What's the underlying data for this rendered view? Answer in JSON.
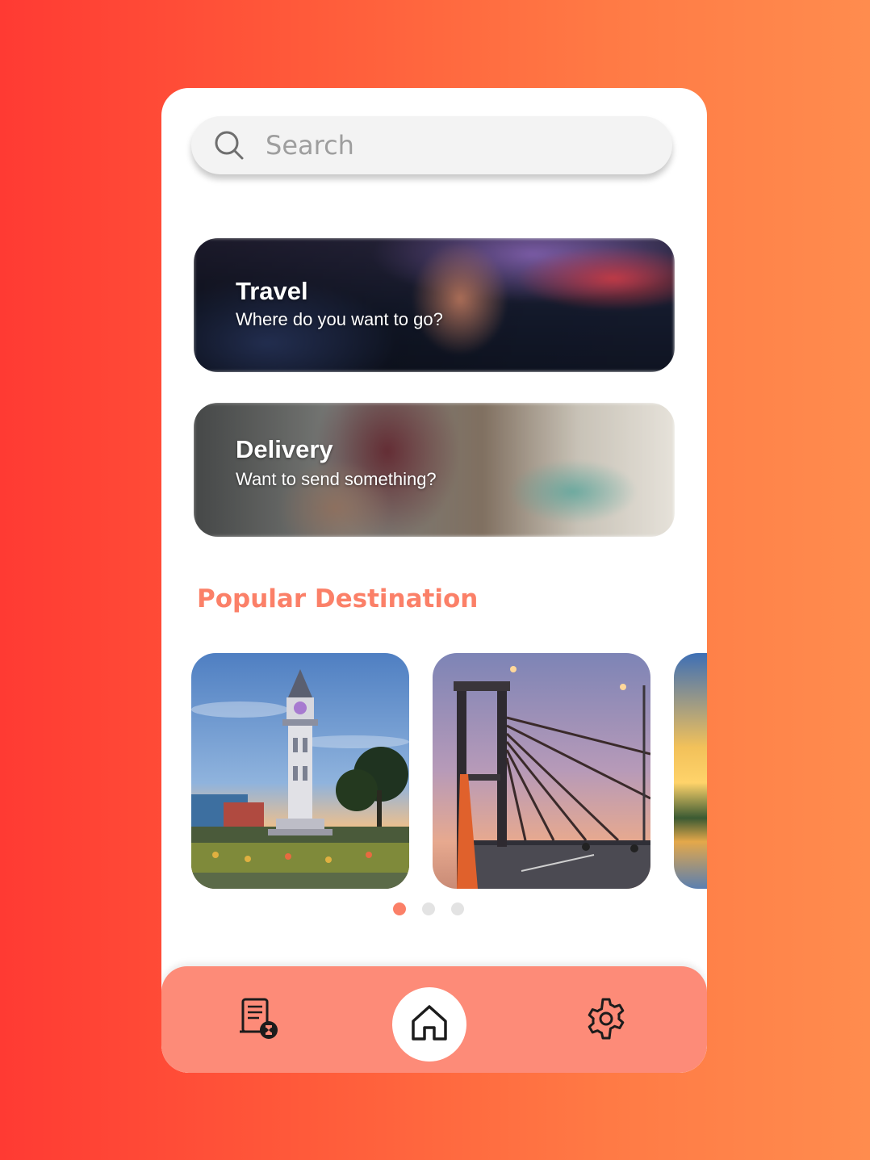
{
  "search": {
    "placeholder": "Search"
  },
  "cards": {
    "travel": {
      "title": "Travel",
      "subtitle": "Where do you want to go?"
    },
    "delivery": {
      "title": "Delivery",
      "subtitle": "Want to send something?"
    }
  },
  "section": {
    "popular_title": "Popular Destination"
  },
  "carousel": {
    "page_count": 3,
    "active_index": 0
  },
  "nav": {
    "items": [
      "history-icon",
      "home-icon",
      "settings-icon"
    ],
    "active": "home-icon"
  },
  "colors": {
    "accent": "#fb8068",
    "navbar": "#fd8b78",
    "background_start": "#ff3a33",
    "background_end": "#ff8c4e"
  }
}
